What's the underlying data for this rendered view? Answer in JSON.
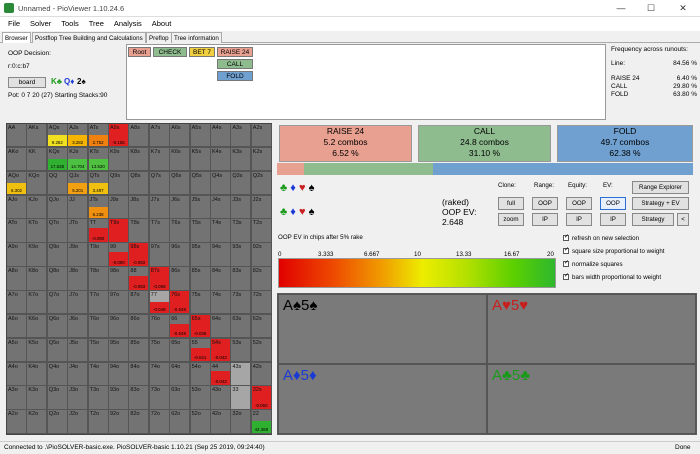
{
  "window": {
    "title": "Unnamed - PioViewer 1.10.24.6"
  },
  "menu": [
    "File",
    "Solver",
    "Tools",
    "Tree",
    "Analysis",
    "About"
  ],
  "tabs": [
    "Browser",
    "Postflop Tree Building and Calculations",
    "Preflop",
    "Tree information"
  ],
  "left": {
    "decision_label": "OOP Decision:",
    "path": "r:0:c:b7",
    "board_button": "board",
    "board_cards": [
      {
        "text": "K♣",
        "color": "#1a9a1a"
      },
      {
        "text": "Q♦",
        "color": "#1a3ad6"
      },
      {
        "text": "2♠",
        "color": "#000000"
      }
    ],
    "pot_text": "Pot: 0 7 20 (27) Starting Stacks:90"
  },
  "tree": {
    "nodes": [
      {
        "label": "Root",
        "color": "#e8a090"
      },
      {
        "label": "CHECK",
        "color": "#8fbc8f"
      },
      {
        "label": "BET 7",
        "color": "#f0d040"
      },
      {
        "label": "RAISE 24",
        "color": "#e8a090"
      },
      {
        "label": "CALL",
        "color": "#8fbc8f"
      },
      {
        "label": "FOLD",
        "color": "#6fa0d0"
      }
    ]
  },
  "freq": {
    "title": "Frequency across runouts:",
    "line_label": "Line:",
    "line_value": "84.56 %",
    "rows": [
      {
        "label": "RAISE 24",
        "value": "6.40 %"
      },
      {
        "label": "CALL",
        "value": "29.80 %"
      },
      {
        "label": "FOLD",
        "value": "63.80 %"
      }
    ]
  },
  "grid": {
    "cells": [
      [
        "AA",
        "AKs",
        "AQs",
        "AJs",
        "ATs",
        "A9s",
        "A8s",
        "A7s",
        "A6s",
        "A5s",
        "A4s",
        "A3s",
        "A2s"
      ],
      [
        "AKo",
        "KK",
        "KQs",
        "KJs",
        "KTs",
        "K9s",
        "K8s",
        "K7s",
        "K6s",
        "K5s",
        "K4s",
        "K3s",
        "K2s"
      ],
      [
        "AQo",
        "KQo",
        "QQ",
        "QJs",
        "QTs",
        "Q9s",
        "Q8s",
        "Q7s",
        "Q6s",
        "Q5s",
        "Q4s",
        "Q3s",
        "Q2s"
      ],
      [
        "AJo",
        "KJo",
        "QJo",
        "JJ",
        "JTs",
        "J9s",
        "J8s",
        "J7s",
        "J6s",
        "J5s",
        "J4s",
        "J3s",
        "J2s"
      ],
      [
        "ATo",
        "KTo",
        "QTo",
        "JTo",
        "TT",
        "T9s",
        "T8s",
        "T7s",
        "T6s",
        "T5s",
        "T4s",
        "T3s",
        "T2s"
      ],
      [
        "A9o",
        "K9o",
        "Q9o",
        "J9o",
        "T9o",
        "99",
        "98s",
        "97s",
        "96s",
        "95s",
        "94s",
        "93s",
        "92s"
      ],
      [
        "A8o",
        "K8o",
        "Q8o",
        "J8o",
        "T8o",
        "98o",
        "88",
        "87s",
        "86s",
        "85s",
        "84s",
        "83s",
        "82s"
      ],
      [
        "A7o",
        "K7o",
        "Q7o",
        "J7o",
        "T7o",
        "97o",
        "87o",
        "77",
        "76s",
        "75s",
        "74s",
        "73s",
        "72s"
      ],
      [
        "A6o",
        "K6o",
        "Q6o",
        "J6o",
        "T6o",
        "96o",
        "86o",
        "76o",
        "66",
        "65s",
        "64s",
        "63s",
        "62s"
      ],
      [
        "A5o",
        "K5o",
        "Q5o",
        "J5o",
        "T5o",
        "95o",
        "85o",
        "75o",
        "65o",
        "55",
        "54s",
        "53s",
        "52s"
      ],
      [
        "A4o",
        "K4o",
        "Q4o",
        "J4o",
        "T4o",
        "94o",
        "84o",
        "74o",
        "64o",
        "54o",
        "44",
        "43s",
        "42s"
      ],
      [
        "A3o",
        "K3o",
        "Q3o",
        "J3o",
        "T3o",
        "93o",
        "83o",
        "73o",
        "63o",
        "53o",
        "43o",
        "33",
        "32s"
      ],
      [
        "A2o",
        "K2o",
        "Q2o",
        "J2o",
        "T2o",
        "92o",
        "82o",
        "72o",
        "62o",
        "52o",
        "42o",
        "32o",
        "22"
      ]
    ],
    "filled": [
      {
        "r": 0,
        "c": 2,
        "color": "#f0e020",
        "ev": "9.282",
        "frac": 0.5
      },
      {
        "r": 0,
        "c": 3,
        "color": "#f4b400",
        "ev": "3.282",
        "frac": 0.5
      },
      {
        "r": 0,
        "c": 4,
        "color": "#f08010",
        "ev": "2.752",
        "frac": 0.5
      },
      {
        "r": 0,
        "c": 5,
        "color": "#e02020",
        "ev": "-0.155",
        "frac": 1.0
      },
      {
        "r": 1,
        "c": 2,
        "color": "#30b030",
        "ev": "17.638",
        "frac": 0.5
      },
      {
        "r": 1,
        "c": 3,
        "color": "#4cc040",
        "ev": "14.704",
        "frac": 0.5
      },
      {
        "r": 1,
        "c": 4,
        "color": "#50c040",
        "ev": "13.530",
        "frac": 0.5
      },
      {
        "r": 2,
        "c": 0,
        "color": "#f0c010",
        "ev": "6.302",
        "frac": 0.5
      },
      {
        "r": 2,
        "c": 3,
        "color": "#f0a010",
        "ev": "5.201",
        "frac": 0.5
      },
      {
        "r": 2,
        "c": 4,
        "color": "#f0c010",
        "ev": "3.497",
        "frac": 0.5
      },
      {
        "r": 3,
        "c": 4,
        "color": "#f09010",
        "ev": "6.238",
        "frac": 0.5
      },
      {
        "r": 4,
        "c": 4,
        "color": "#e02020",
        "ev": "-0.090",
        "frac": 0.6
      },
      {
        "r": 4,
        "c": 5,
        "color": "#e02020",
        "ev": "",
        "frac": 1.0
      },
      {
        "r": 5,
        "c": 5,
        "color": "#e02020",
        "ev": "-0.090",
        "frac": 0.6
      },
      {
        "r": 5,
        "c": 6,
        "color": "#e02020",
        "ev": "-0.083",
        "frac": 1.0
      },
      {
        "r": 6,
        "c": 6,
        "color": "#e02020",
        "ev": "-0.083",
        "frac": 0.6
      },
      {
        "r": 6,
        "c": 7,
        "color": "#e02020",
        "ev": "-0.058",
        "frac": 1.0
      },
      {
        "r": 7,
        "c": 8,
        "color": "#e02020",
        "ev": "-0.048",
        "frac": 1.0
      },
      {
        "r": 7,
        "c": 7,
        "color": "#e02020",
        "ev": "-0.048",
        "frac": 0.5
      },
      {
        "r": 8,
        "c": 8,
        "color": "#e02020",
        "ev": "-0.048",
        "frac": 0.6
      },
      {
        "r": 8,
        "c": 9,
        "color": "#e02020",
        "ev": "-0.038",
        "frac": 1.0
      },
      {
        "r": 9,
        "c": 9,
        "color": "#e02020",
        "ev": "-0.041",
        "frac": 0.6
      },
      {
        "r": 9,
        "c": 10,
        "color": "#e02020",
        "ev": "-0.043",
        "frac": 1.0
      },
      {
        "r": 10,
        "c": 10,
        "color": "#e02020",
        "ev": "-0.043",
        "frac": 0.6
      },
      {
        "r": 11,
        "c": 12,
        "color": "#e02020",
        "ev": "-0.060",
        "frac": 1.0
      },
      {
        "r": 12,
        "c": 12,
        "color": "#30b030",
        "ev": "42.388",
        "frac": 0.5
      }
    ],
    "highlighted": [
      {
        "r": 7,
        "c": 7
      },
      {
        "r": 10,
        "c": 11
      },
      {
        "r": 11,
        "c": 11
      }
    ]
  },
  "actions": [
    {
      "name": "RAISE 24",
      "combos": "5.2 combos",
      "pct": "6.52 %",
      "color": "#e8a090"
    },
    {
      "name": "CALL",
      "combos": "24.8 combos",
      "pct": "31.10 %",
      "color": "#8fbc8f"
    },
    {
      "name": "FOLD",
      "combos": "49.7 combos",
      "pct": "62.38 %",
      "color": "#6fa0d0"
    }
  ],
  "stripe": [
    {
      "color": "#e8a090",
      "frac": 0.0652
    },
    {
      "color": "#8fbc8f",
      "frac": 0.311
    },
    {
      "color": "#6fa0d0",
      "frac": 0.6238
    }
  ],
  "controls": {
    "raked": "(raked)",
    "oop_ev_label": "OOP EV:",
    "oop_ev_value": "2.648",
    "clone_label": "Clone:",
    "range_label": "Range:",
    "equity_label": "Equity:",
    "ev_label": "EV:",
    "full": "full",
    "zoom": "zoom",
    "oop": "OOP",
    "ip": "IP",
    "range_explorer": "Range Explorer",
    "strategy_ev": "Strategy + EV",
    "strategy": "Strategy",
    "back": "<",
    "checkboxes": [
      "refresh on new selection",
      "square size proportional to weight",
      "normalize squares",
      "bars width proportional to weight"
    ]
  },
  "scale": {
    "title": "OOP EV in chips after 5% rake",
    "ticks": [
      "0",
      "3.333",
      "6.667",
      "10",
      "13.33",
      "16.67",
      "20"
    ]
  },
  "combos": [
    {
      "text": "A♠5♠",
      "color": "#000000"
    },
    {
      "text": "A♥5♥",
      "color": "#c81e1e"
    },
    {
      "text": "A♦5♦",
      "color": "#1a3ad6"
    },
    {
      "text": "A♣5♣",
      "color": "#1a9a1a"
    }
  ],
  "status": {
    "left": "Connected to .\\PioSOLVER-basic.exe. PioSOLVER-basic 1.10.21 (Sep 25 2019, 09:24:40)",
    "right": "Done"
  }
}
